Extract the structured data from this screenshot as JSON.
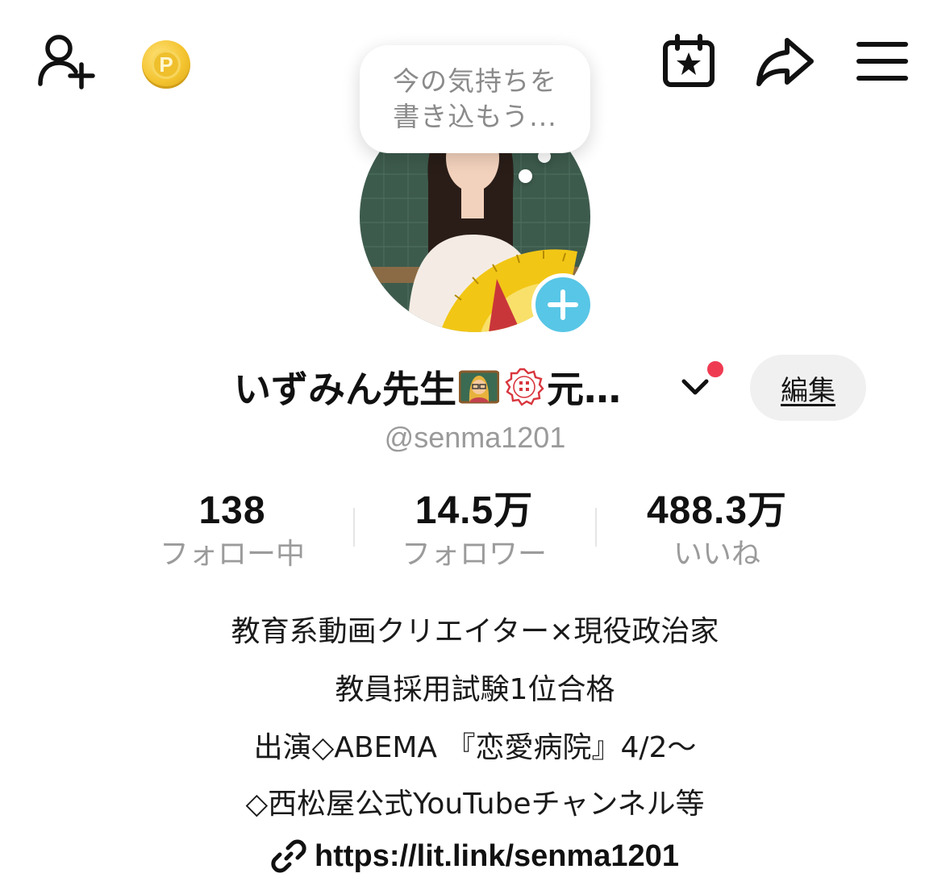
{
  "topbar": {
    "add_friend_icon": "person-plus-icon",
    "coin_icon": "coin-p-icon",
    "coin_letter": "P",
    "calendar_icon": "calendar-star-icon",
    "share_icon": "share-arrow-icon",
    "menu_icon": "hamburger-menu-icon"
  },
  "bubble": {
    "line1": "今の気持ちを",
    "line2": "書き込もう..."
  },
  "profile": {
    "name": "いずみん先生",
    "name_suffix": "元…",
    "handle": "@senma1201",
    "edit_label": "編集",
    "notification_color": "#ef3b52",
    "add_button_color": "#58c6e6"
  },
  "stats": [
    {
      "value": "138",
      "label": "フォロー中"
    },
    {
      "value": "14.5万",
      "label": "フォロワー"
    },
    {
      "value": "488.3万",
      "label": "いいね"
    }
  ],
  "bio": {
    "line1": "教育系動画クリエイター×現役政治家",
    "line2": "教員採用試験1位合格",
    "line3": "出演◇ABEMA 『恋愛病院』4/2〜",
    "line4": "◇西松屋公式YouTubeチャンネル等",
    "link": "https://lit.link/senma1201",
    "link_icon": "link-chain-icon"
  }
}
